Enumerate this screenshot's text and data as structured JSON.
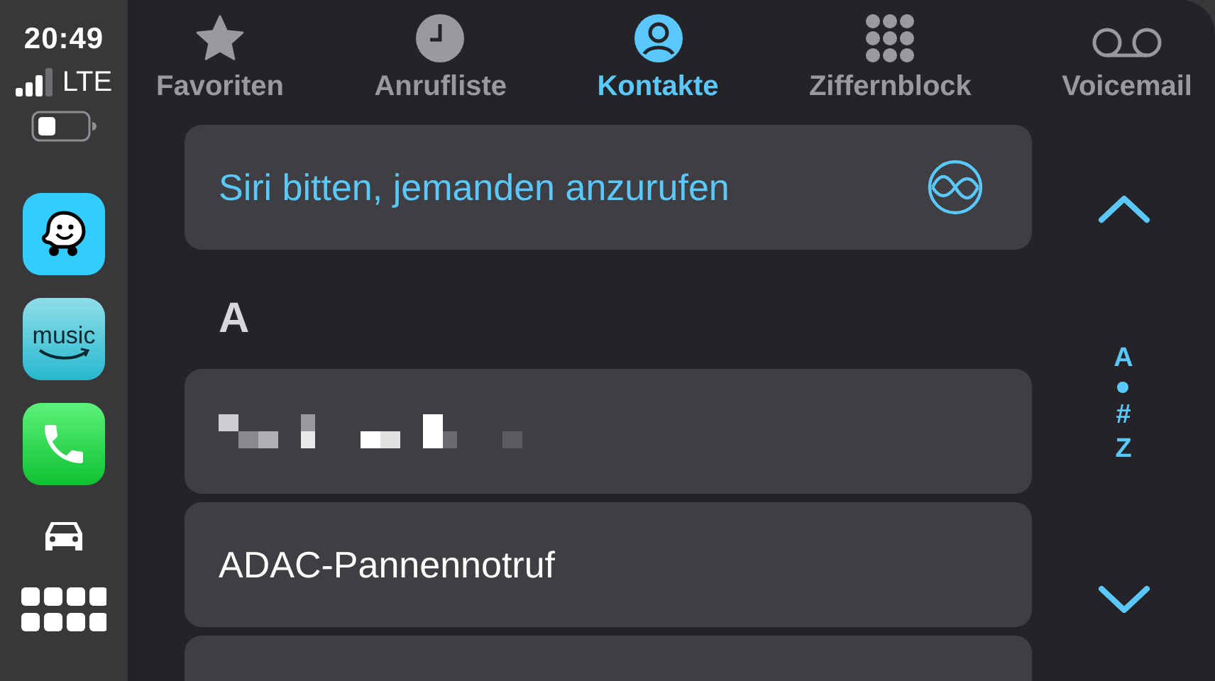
{
  "status_bar": {
    "time": "20:49",
    "network": "LTE"
  },
  "dock": [
    {
      "kind": "waze"
    },
    {
      "kind": "music",
      "label": "music"
    },
    {
      "kind": "phone"
    },
    {
      "kind": "car"
    },
    {
      "kind": "grid"
    }
  ],
  "tabs": [
    {
      "label": "Favoriten",
      "kind": "star",
      "selected": false
    },
    {
      "label": "Anrufliste",
      "kind": "clock",
      "selected": false
    },
    {
      "label": "Kontakte",
      "kind": "person",
      "selected": true
    },
    {
      "label": "Ziffernblock",
      "kind": "keypad",
      "selected": false
    },
    {
      "label": "Voicemail",
      "kind": "voicemail",
      "selected": false
    }
  ],
  "list": [
    {
      "kind": "siri",
      "text": "Siri bitten, jemanden anzurufen"
    },
    {
      "kind": "header",
      "text": "A"
    },
    {
      "kind": "redacted"
    },
    {
      "kind": "contact",
      "text": "ADAC-Pannennotruf"
    },
    {
      "kind": "redacted"
    }
  ],
  "index": [
    {
      "kind": "letter",
      "text": "A"
    },
    {
      "kind": "dot"
    },
    {
      "kind": "letter",
      "text": "#"
    },
    {
      "kind": "letter",
      "text": "Z"
    }
  ]
}
